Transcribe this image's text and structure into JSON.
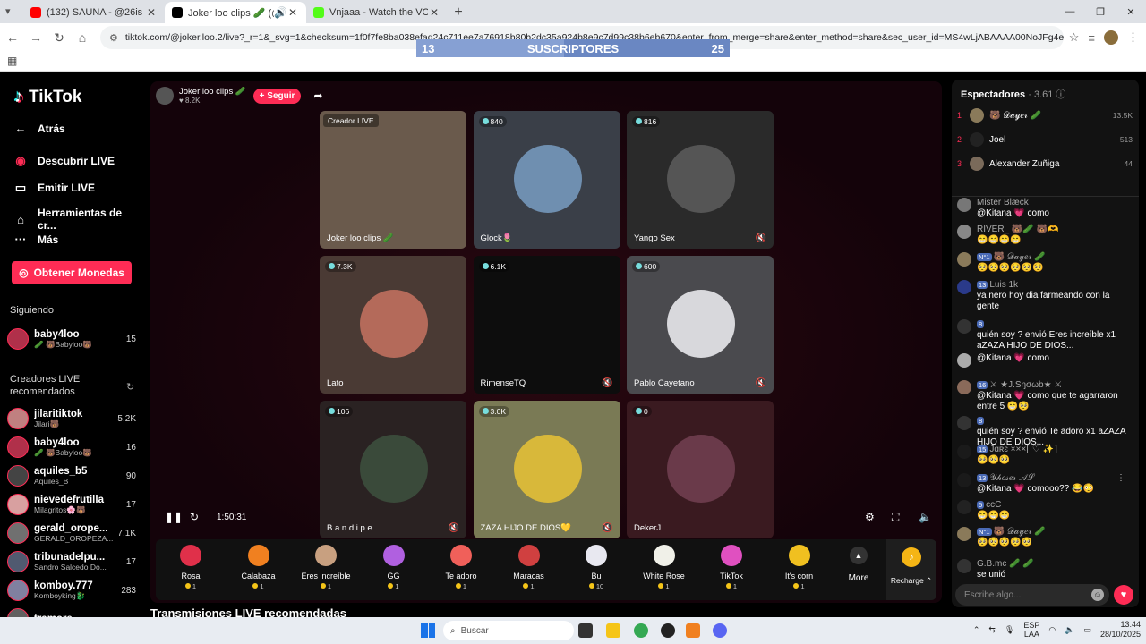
{
  "browser": {
    "tabs": [
      {
        "title": "(132) SAUNA - @26is - YouTube",
        "color": "#ff0000"
      },
      {
        "title": "Joker loo clips 🥒 (@joker.l...",
        "color": "#000000"
      },
      {
        "title": "Vnjaaa - Watch the VOD on Kic...",
        "color": "#53fc18"
      }
    ],
    "url": "tiktok.com/@joker.loo.2/live?_r=1&_svg=1&checksum=1f0f7fe8ba038efad24c711ee7a76918b80b2dc35a924b8e9c7d99c38b6eb670&enter_from_merge=share&enter_method=share&sec_user_id=MS4wLjABAAAA00NoJFg4ehk1Wa4ShZ2n_Acuqv_tVxR..."
  },
  "overlay": {
    "left": "13",
    "label": "SUSCRIPTORES",
    "right": "25",
    "progress": 0.47
  },
  "nav": {
    "logo": "TikTok",
    "back": "Atrás",
    "discover": "Descubrir LIVE",
    "go_live": "Emitir LIVE",
    "tools": "Herramientas de cr...",
    "more": "Más",
    "coins": "Obtener Monedas",
    "following_title": "Siguiendo",
    "following": [
      {
        "name": "baby4loo",
        "sub": "🥒 🐻Babyloo🐻",
        "count": "15"
      }
    ],
    "recommended_title": "Creadores LIVE recomendados",
    "recommended": [
      {
        "name": "jilaritiktok",
        "sub": "Jilari🐻",
        "count": "5.2K"
      },
      {
        "name": "baby4loo",
        "sub": "🥒 🐻Babyloo🐻",
        "count": "16"
      },
      {
        "name": "aquiles_b5",
        "sub": "Aquiles_B",
        "count": "90"
      },
      {
        "name": "nievedefrutilla",
        "sub": "Milagritos🌸🐻",
        "count": "17"
      },
      {
        "name": "gerald_orope...",
        "sub": "GERALD_OROPEZA...",
        "count": "7.1K"
      },
      {
        "name": "tribunadelpu...",
        "sub": "Sandro Salcedo Do...",
        "count": "17"
      },
      {
        "name": "komboy.777",
        "sub": "Komboyking🐉",
        "count": "283"
      },
      {
        "name": "tramore",
        "sub": "",
        "count": ""
      }
    ]
  },
  "stage": {
    "host_name": "Joker loo clips 🥒",
    "host_likes": "♥ 8.2K",
    "follow": "+ Seguir",
    "time": "1:50:31",
    "cells": [
      {
        "views": "",
        "name": "Joker loo clips 🥒",
        "creator_tag": "Creador LIVE",
        "bg": "#6a5a4c",
        "pic": ""
      },
      {
        "views": "840",
        "name": "Glock🌷",
        "bg": "#3a3f48",
        "pic": "#6f8fb0"
      },
      {
        "views": "816",
        "name": "Yango Sex",
        "bg": "#2a2a2a",
        "pic": "#555555"
      },
      {
        "views": "7.3K",
        "name": "Lato",
        "bg": "#4a3a34",
        "pic": "#b46a5a"
      },
      {
        "views": "6.1K",
        "name": "RimenseTQ",
        "bg": "#0d0d0d",
        "pic": ""
      },
      {
        "views": "600",
        "name": "Pablo Cayetano",
        "bg": "#4a4a4e",
        "pic": "#d8d8dc"
      },
      {
        "views": "106",
        "name": "B a n d i p e",
        "bg": "#2a2222",
        "pic": "#3a4a3a"
      },
      {
        "views": "3.0K",
        "name": "ZAZA HIJO DE DIOS💛",
        "bg": "#7a7a55",
        "pic": "#d8b83a"
      },
      {
        "views": "0",
        "name": "DekerJ",
        "bg": "#3a1a20",
        "pic": "#6a3a4a"
      }
    ],
    "gifts": [
      {
        "name": "Rosa",
        "price": "1",
        "color": "#e0304a"
      },
      {
        "name": "Calabaza",
        "price": "1",
        "color": "#f08020"
      },
      {
        "name": "Eres increíble",
        "price": "1",
        "color": "#c8a080"
      },
      {
        "name": "GG",
        "price": "1",
        "color": "#b060e0"
      },
      {
        "name": "Te adoro",
        "price": "1",
        "color": "#f0605a"
      },
      {
        "name": "Maracas",
        "price": "1",
        "color": "#d04040"
      },
      {
        "name": "Bu",
        "price": "10",
        "color": "#e8e8f0"
      },
      {
        "name": "White Rose",
        "price": "1",
        "color": "#f0f0e8"
      },
      {
        "name": "TikTok",
        "price": "1",
        "color": "#e050c0"
      },
      {
        "name": "It's corn",
        "price": "1",
        "color": "#f0c020"
      }
    ],
    "more": "More",
    "recharge": "Recharge ⌃"
  },
  "bottom_title": "Transmisiones LIVE recomendadas",
  "chat": {
    "title": "Espectadores",
    "count": "· 3.61",
    "ranking": [
      {
        "rank": "1",
        "name": "🐻 𝒟𝒶𝓎𝑒𝓇 🥒",
        "value": "13.5K",
        "color": "#8a7a5a"
      },
      {
        "rank": "2",
        "name": "Joel",
        "value": "513",
        "color": "#222"
      },
      {
        "rank": "3",
        "name": "Alexander Zuñiga",
        "value": "44",
        "color": "#7a6a5a"
      }
    ],
    "messages": [
      {
        "user": "Mister Blæck",
        "badge": "",
        "text": "@Kitana 💗 como",
        "color": "#777"
      },
      {
        "user": "RIVER_ 🐻🥒 🐻🫶",
        "badge": "",
        "text": "😁😁😁😁",
        "color": "#888"
      },
      {
        "user": "🐻 𝒟𝒶𝓎𝑒𝓇 🥒",
        "badge": "N°1",
        "text": "🥺🥺🥺🥺🥺🥺",
        "color": "#8a7a5a"
      },
      {
        "user": "Luis 1k",
        "badge": "13",
        "text": "ya nero hoy dia farmeando con la gente",
        "color": "#2a3a8a"
      },
      {
        "user": "",
        "badge": "8",
        "text": "quién soy ? envió Eres increíble x1 aZAZA HIJO DE DIOS...",
        "color": "#333"
      },
      {
        "user": "",
        "badge": "",
        "text": "@Kitana 💗 como",
        "color": "#aaa"
      },
      {
        "user": "⚔ ★J.Sŋσωb★ ⚔",
        "badge": "16",
        "text": "@Kitana 💗 como que te agarraron entre 5 😁🥺",
        "color": "#8a6a5a"
      },
      {
        "user": "",
        "badge": "8",
        "text": "quién soy ? envió Te adoro x1 aZAZA HIJO DE DIOS...",
        "color": "#333"
      },
      {
        "user": "Jɑʀɛ ×××⌈ ♡ ✨⌉",
        "badge": "15",
        "text": "🥺🥺🥺",
        "color": "#1a1a1a"
      },
      {
        "user": "𝒴𝒽𝑜𝓈𝑒𝓇 𝒜𝒮",
        "badge": "13",
        "text": "@Kitana 💗 comooo?? 😂😳",
        "color": "#1a1a1a"
      },
      {
        "user": "ccC",
        "badge": "5",
        "text": "😁😁😁",
        "color": "#222"
      },
      {
        "user": "🐻 𝒟𝒶𝓎𝑒𝓇 🥒",
        "badge": "N°1",
        "text": "🥺🥺🥺🥺🥺",
        "color": "#8a7a5a"
      },
      {
        "user": "G.B.mc 🥒 🥒",
        "badge": "",
        "text": "se unió",
        "color": "#333"
      }
    ],
    "input_placeholder": "Escribe algo..."
  },
  "taskbar": {
    "search": "Buscar",
    "lang_top": "ESP",
    "lang_bottom": "LAA",
    "time": "13:44",
    "date": "28/10/2025"
  }
}
